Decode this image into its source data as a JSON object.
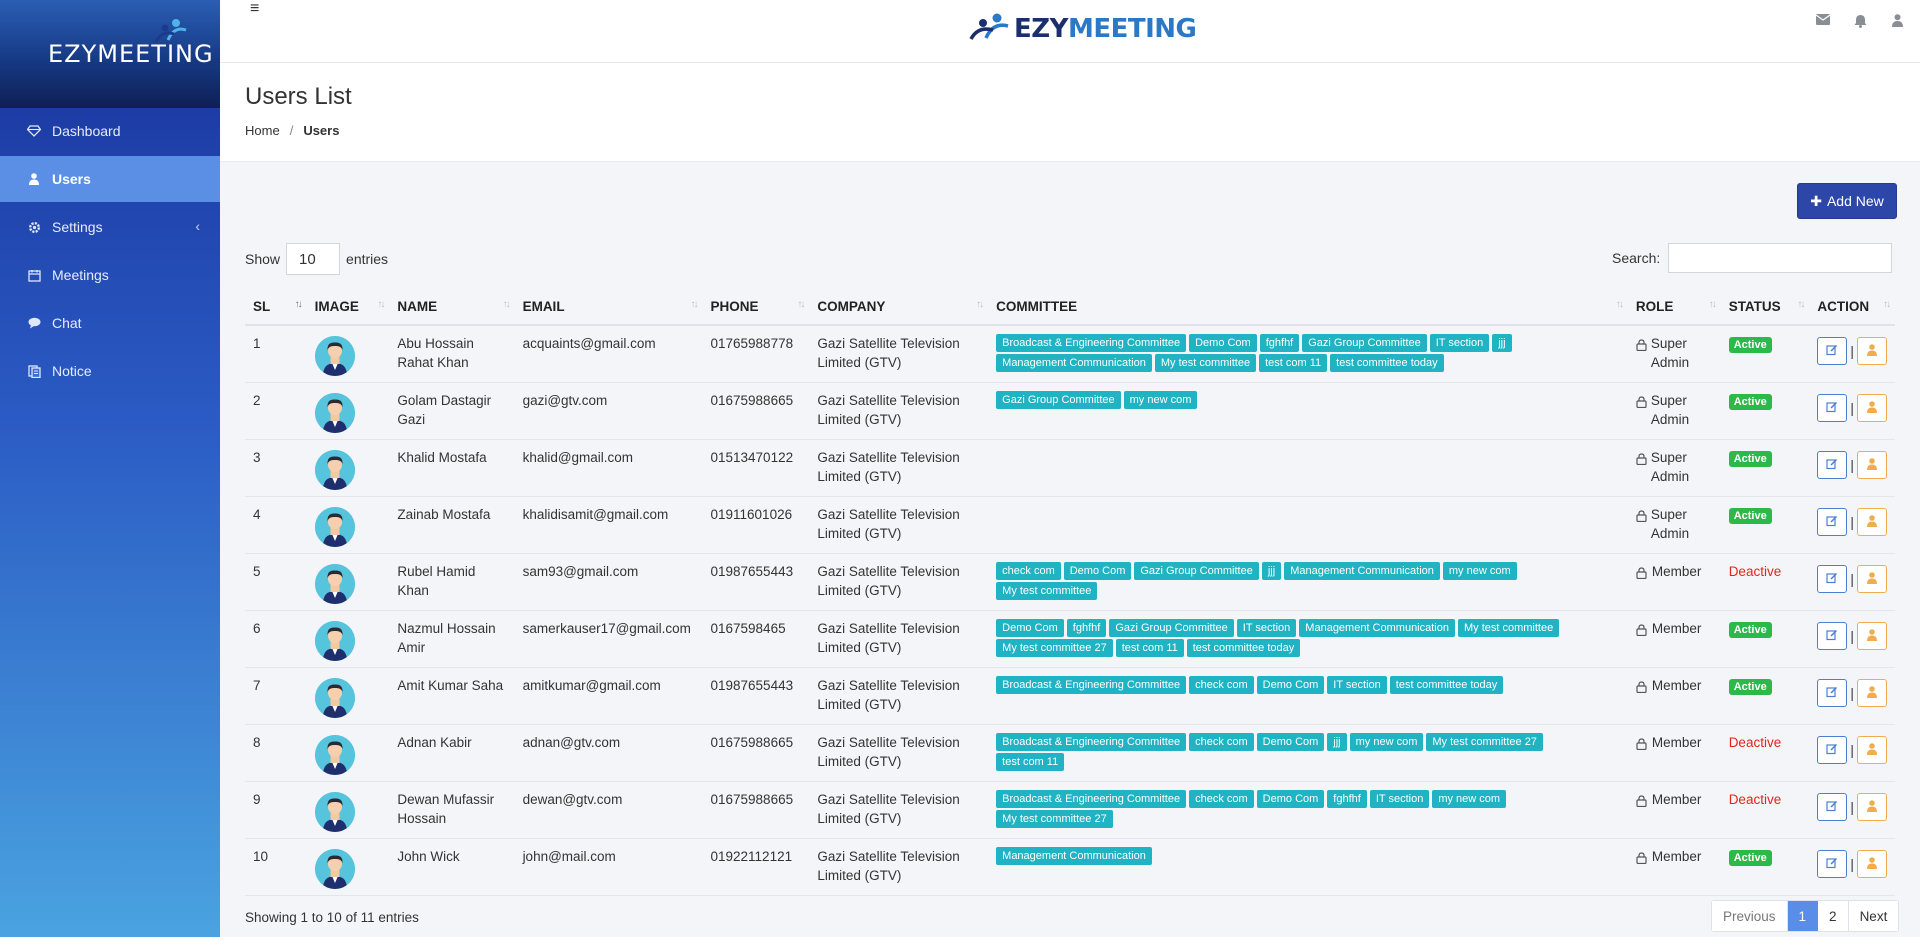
{
  "brand": {
    "name": "EZYMEETING",
    "top_part1": "EZY",
    "top_part2": "MEETING"
  },
  "sidebar": {
    "items": [
      {
        "label": "Dashboard",
        "icon": "diamond-icon"
      },
      {
        "label": "Users",
        "icon": "user-icon",
        "active": true
      },
      {
        "label": "Settings",
        "icon": "gear-icon",
        "chevron": "‹"
      },
      {
        "label": "Meetings",
        "icon": "calendar-icon"
      },
      {
        "label": "Chat",
        "icon": "chat-icon"
      },
      {
        "label": "Notice",
        "icon": "notice-icon"
      }
    ]
  },
  "topbar": {
    "menu_icon": "≡",
    "icons": [
      "envelope-icon",
      "bell-icon",
      "user-icon"
    ]
  },
  "page": {
    "title": "Users List",
    "breadcrumb": {
      "home": "Home",
      "sep": "/",
      "current": "Users"
    },
    "add_button": "Add New",
    "add_plus": "✚",
    "show_label": "Show",
    "entries_value": "10",
    "entries_label": "entries",
    "search_label": "Search:"
  },
  "table": {
    "headers": {
      "sl": "SL",
      "image": "IMAGE",
      "name": "NAME",
      "email": "EMAIL",
      "phone": "PHONE",
      "company": "COMPANY",
      "committee": "COMMITTEE",
      "role": "ROLE",
      "status": "STATUS",
      "action": "ACTION"
    },
    "rows": [
      {
        "sl": "1",
        "name": "Abu Hossain Rahat Khan",
        "email": "acquaints@gmail.com",
        "phone": "01765988778",
        "company": "Gazi Satellite Television Limited (GTV)",
        "committees": [
          "Broadcast & Engineering Committee",
          "Demo Com",
          "fghfhf",
          "Gazi Group Committee",
          "IT section",
          "jjj",
          "Management Communication",
          "My test committee",
          "test com 11",
          "test committee today"
        ],
        "role": "Super Admin",
        "status": "Active"
      },
      {
        "sl": "2",
        "name": "Golam Dastagir Gazi",
        "email": "gazi@gtv.com",
        "phone": "01675988665",
        "company": "Gazi Satellite Television Limited (GTV)",
        "committees": [
          "Gazi Group Committee",
          "my new com"
        ],
        "role": "Super Admin",
        "status": "Active"
      },
      {
        "sl": "3",
        "name": "Khalid Mostafa",
        "email": "khalid@gmail.com",
        "phone": "01513470122",
        "company": "Gazi Satellite Television Limited (GTV)",
        "committees": [],
        "role": "Super Admin",
        "status": "Active"
      },
      {
        "sl": "4",
        "name": "Zainab Mostafa",
        "email": "khalidisamit@gmail.com",
        "phone": "01911601026",
        "company": "Gazi Satellite Television Limited (GTV)",
        "committees": [],
        "role": "Super Admin",
        "status": "Active"
      },
      {
        "sl": "5",
        "name": "Rubel Hamid Khan",
        "email": "sam93@gmail.com",
        "phone": "01987655443",
        "company": "Gazi Satellite Television Limited (GTV)",
        "committees": [
          "check com",
          "Demo Com",
          "Gazi Group Committee",
          "jjj",
          "Management Communication",
          "my new com",
          "My test committee"
        ],
        "role": "Member",
        "status": "Deactive"
      },
      {
        "sl": "6",
        "name": "Nazmul Hossain Amir",
        "email": "samerkauser17@gmail.com",
        "phone": "0167598465",
        "company": "Gazi Satellite Television Limited (GTV)",
        "committees": [
          "Demo Com",
          "fghfhf",
          "Gazi Group Committee",
          "IT section",
          "Management Communication",
          "My test committee",
          "My test committee 27",
          "test com 11",
          "test committee today"
        ],
        "role": "Member",
        "status": "Active"
      },
      {
        "sl": "7",
        "name": "Amit Kumar Saha",
        "email": "amitkumar@gmail.com",
        "phone": "01987655443",
        "company": "Gazi Satellite Television Limited (GTV)",
        "committees": [
          "Broadcast & Engineering Committee",
          "check com",
          "Demo Com",
          "IT section",
          "test committee today"
        ],
        "role": "Member",
        "status": "Active"
      },
      {
        "sl": "8",
        "name": "Adnan Kabir",
        "email": "adnan@gtv.com",
        "phone": "01675988665",
        "company": "Gazi Satellite Television Limited (GTV)",
        "committees": [
          "Broadcast & Engineering Committee",
          "check com",
          "Demo Com",
          "jjj",
          "my new com",
          "My test committee 27",
          "test com 11"
        ],
        "role": "Member",
        "status": "Deactive"
      },
      {
        "sl": "9",
        "name": "Dewan Mufassir Hossain",
        "email": "dewan@gtv.com",
        "phone": "01675988665",
        "company": "Gazi Satellite Television Limited (GTV)",
        "committees": [
          "Broadcast & Engineering Committee",
          "check com",
          "Demo Com",
          "fghfhf",
          "IT section",
          "my new com",
          "My test committee 27"
        ],
        "role": "Member",
        "status": "Deactive"
      },
      {
        "sl": "10",
        "name": "John Wick",
        "email": "john@mail.com",
        "phone": "01922112121",
        "company": "Gazi Satellite Television Limited (GTV)",
        "committees": [
          "Management Communication"
        ],
        "role": "Member",
        "status": "Active"
      }
    ],
    "action_separator": "|"
  },
  "footer": {
    "showing": "Showing 1 to 10 of 11 entries",
    "pagination": {
      "previous": "Previous",
      "pages": [
        "1",
        "2"
      ],
      "current": "1",
      "next": "Next"
    }
  },
  "colors": {
    "sidebar_top": "#18329a",
    "sidebar_bottom": "#4aa3e0",
    "active_nav": "#5b8fe6",
    "tag": "#1fb3c4",
    "active_badge": "#2db84a",
    "deactive": "#e0261a",
    "add_button": "#2d47a8"
  }
}
